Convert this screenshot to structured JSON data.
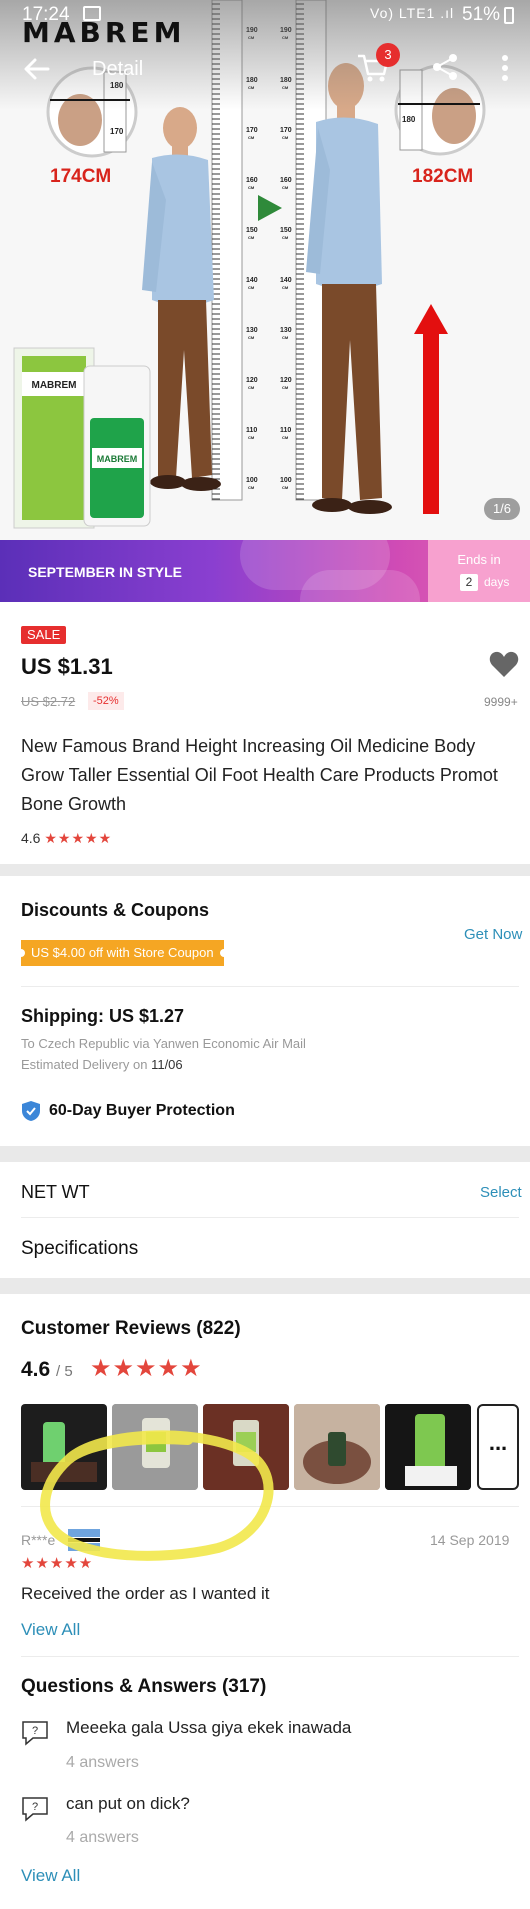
{
  "status_bar": {
    "time": "17:24",
    "signal": "Vo) LTE1 .ıl",
    "battery": "51%"
  },
  "brand": "MABREM",
  "nav": {
    "title": "Detail",
    "cart_count": "3"
  },
  "hero": {
    "left_height": "174CM",
    "right_height": "182CM",
    "left_zoom_marks": [
      "180",
      "170"
    ],
    "right_zoom_marks": [
      "180"
    ],
    "ruler_marks": [
      "190",
      "180",
      "170",
      "160",
      "150",
      "140",
      "130",
      "120",
      "110",
      "100"
    ],
    "ruler_unit": "CM",
    "product_box_label": "MABREM",
    "product_bottle_label": "MABREM",
    "image_counter": "1/6"
  },
  "banner": {
    "title": "SEPTEMBER IN STYLE",
    "ends_label": "Ends in",
    "days_value": "2",
    "days_label": "days"
  },
  "product": {
    "sale_badge": "SALE",
    "price": "US $1.31",
    "old_price": "US $2.72",
    "discount": "-52%",
    "wish_count": "9999+",
    "title": "New Famous Brand Height Increasing Oil Medicine Body Grow Taller Essential Oil Foot Health Care Products Promot Bone Growth",
    "rating": "4.6",
    "stars": "★★★★★"
  },
  "discounts": {
    "title": "Discounts & Coupons",
    "coupon": "US $4.00 off with Store Coupon",
    "get_now": "Get Now"
  },
  "shipping": {
    "title": "Shipping: US $1.27",
    "route": "To Czech Republic via Yanwen Economic Air Mail",
    "delivery_label": "Estimated Delivery on",
    "delivery_date": "11/06"
  },
  "protection": "60-Day Buyer Protection",
  "options": {
    "net_wt": "NET WT",
    "select": "Select",
    "specifications": "Specifications"
  },
  "reviews": {
    "title": "Customer Reviews (822)",
    "score": "4.6",
    "out_of": "/ 5",
    "stars": "★★★★★",
    "more": "...",
    "reviewer": "R***e",
    "date": "14 Sep 2019",
    "review_stars": "★★★★★",
    "text": "Received the order as I wanted it",
    "view_all": "View All"
  },
  "qa": {
    "title": "Questions & Answers (317)",
    "icon_glyph": "?",
    "items": [
      {
        "question": "Meeeka gala Ussa giya ekek inawada",
        "answers": "4 answers"
      },
      {
        "question": "can put on dick?",
        "answers": "4 answers"
      }
    ],
    "view_all": "View All"
  },
  "colors": {
    "accent_red": "#e62e2e",
    "link_blue": "#2d8fb8",
    "coupon_orange": "#f5a623",
    "star_red": "#e3463c",
    "highlight_yellow": "#f2e84b"
  }
}
